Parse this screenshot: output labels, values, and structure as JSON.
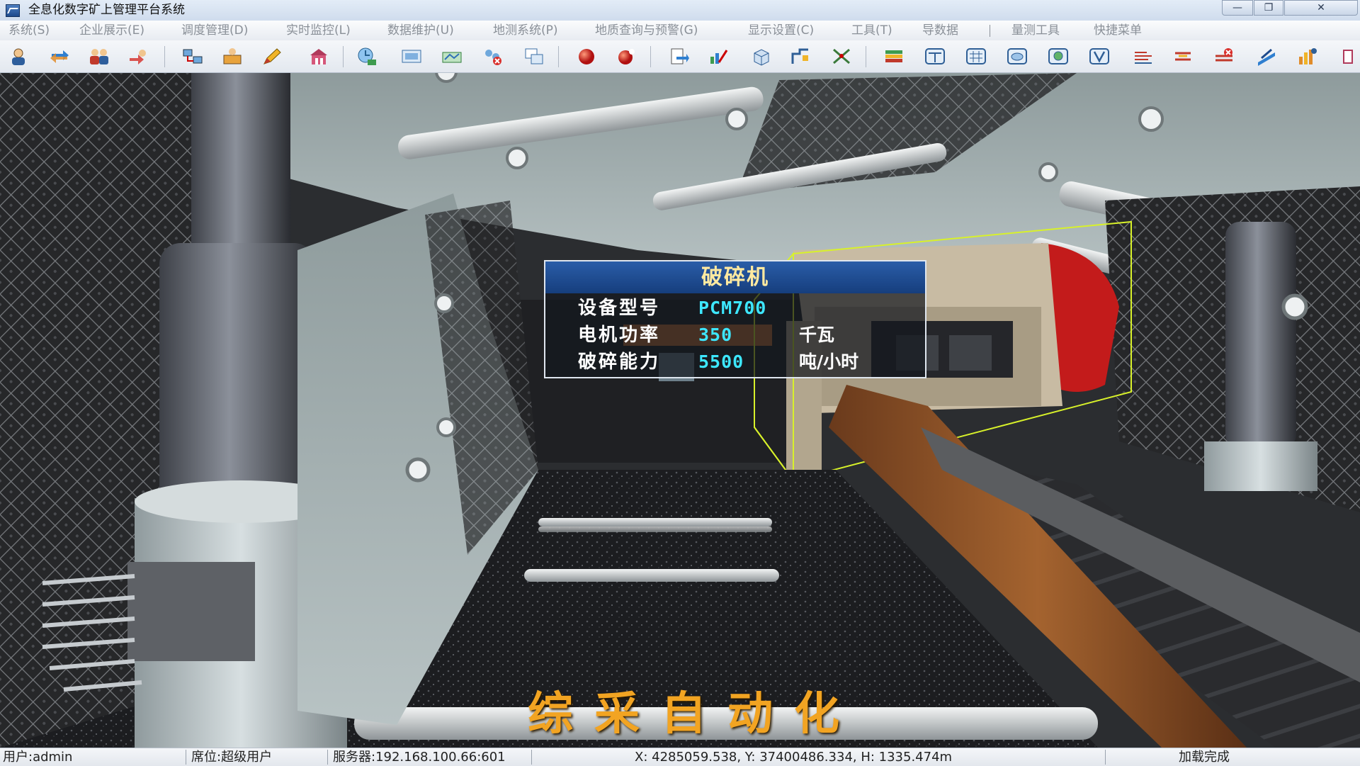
{
  "window": {
    "title": "全息化数字矿上管理平台系统",
    "controls": {
      "minimize": "—",
      "maximize": "❐",
      "close": "✕"
    }
  },
  "menu": {
    "items": [
      {
        "label": "系统(S)"
      },
      {
        "label": "企业展示(E)"
      },
      {
        "label": "调度管理(D)"
      },
      {
        "label": "实时监控(L)"
      },
      {
        "label": "数据维护(U)"
      },
      {
        "label": "地测系统(P)"
      },
      {
        "label": "地质查询与预警(G)"
      },
      {
        "label": "显示设置(C)"
      },
      {
        "label": "工具(T)"
      },
      {
        "label": "导数据"
      },
      {
        "label": "量测工具"
      },
      {
        "label": "快捷菜单"
      }
    ]
  },
  "toolbar": {
    "buttons": [
      {
        "icon": "user-icon"
      },
      {
        "icon": "refresh-arrows-icon"
      },
      {
        "icon": "users-group-icon"
      },
      {
        "icon": "transfer-icon"
      },
      {
        "icon": "network-icon"
      },
      {
        "icon": "monitor-person-icon"
      },
      {
        "icon": "pen-icon"
      },
      {
        "icon": "building-icon"
      },
      {
        "icon": "globe-clock-icon"
      },
      {
        "icon": "display-icon"
      },
      {
        "icon": "map-network-icon"
      },
      {
        "icon": "delete-nodes-icon"
      },
      {
        "icon": "copy-window-icon"
      },
      {
        "icon": "red-sphere-icon"
      },
      {
        "icon": "red-sphere-star-icon"
      },
      {
        "icon": "document-arrow-icon"
      },
      {
        "icon": "chart-edit-icon"
      },
      {
        "icon": "cube-view-icon"
      },
      {
        "icon": "measure-icon"
      },
      {
        "icon": "cross-tools-icon"
      },
      {
        "icon": "layers-icon"
      },
      {
        "icon": "tunnel-section-icon"
      },
      {
        "icon": "grid-frame-icon"
      },
      {
        "icon": "cloud-frame-icon"
      },
      {
        "icon": "globe-frame-icon"
      },
      {
        "icon": "v-frame-icon"
      },
      {
        "icon": "striped-lines-icon"
      },
      {
        "icon": "double-lines-icon"
      },
      {
        "icon": "delete-lines-icon"
      },
      {
        "icon": "plane-icon"
      },
      {
        "icon": "bar-chart-icon"
      },
      {
        "icon": "overflow-icon"
      }
    ]
  },
  "popup": {
    "title": "破碎机",
    "rows": [
      {
        "label": "设备型号",
        "value": "PCM700",
        "unit": ""
      },
      {
        "label": "电机功率",
        "value": "350",
        "unit": "千瓦"
      },
      {
        "label": "破碎能力",
        "value": "5500",
        "unit": "吨/小时"
      }
    ]
  },
  "caption": "综采自动化",
  "status": {
    "user": "用户:admin",
    "role": "席位:超级用户",
    "server": "服务器:192.168.100.66:601",
    "coords": "X: 4285059.538, Y: 37400486.334, H: 1335.474m",
    "state": "加载完成"
  }
}
